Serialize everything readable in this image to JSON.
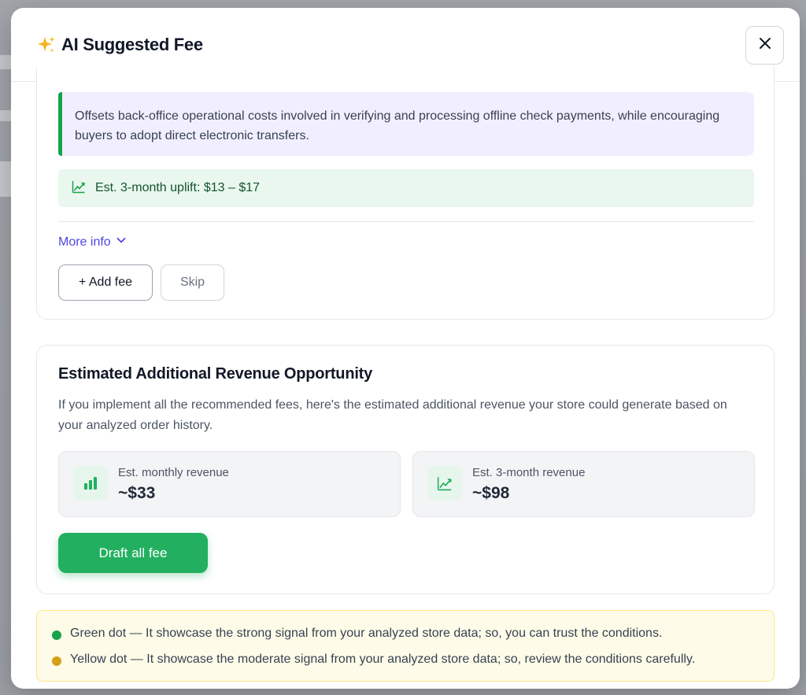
{
  "modal": {
    "title": "AI Suggested Fee",
    "close_icon": "close-icon",
    "sparkle_icon": "sparkle-icon"
  },
  "fee_card": {
    "description": "Offsets back-office operational costs involved in verifying and processing offline check payments, while encouraging buyers to adopt direct electronic transfers.",
    "uplift_icon": "trend-up-icon",
    "uplift_text": "Est. 3-month uplift: $13 – $17",
    "more_info_label": "More info",
    "add_fee_label": "+ Add fee",
    "skip_label": "Skip"
  },
  "revenue_card": {
    "title": "Estimated Additional Revenue Opportunity",
    "subtitle": "If you implement all the recommended fees, here's the estimated additional revenue your store could generate based on your analyzed order history.",
    "stats": [
      {
        "icon": "bar-chart-icon",
        "label": "Est. monthly revenue",
        "value": "~$33"
      },
      {
        "icon": "trend-up-icon",
        "label": "Est. 3-month revenue",
        "value": "~$98"
      }
    ],
    "draft_button_label": "Draft all fee"
  },
  "legend": {
    "items": [
      {
        "color": "#16a34a",
        "text": "Green dot — It showcase the strong signal from your analyzed store data; so, you can trust the conditions."
      },
      {
        "color": "#d4a017",
        "text": "Yellow dot — It showcase the moderate signal from your analyzed store data; so, review the conditions carefully."
      }
    ]
  },
  "colors": {
    "accent_green": "#22b060",
    "link_indigo": "#4f46e5",
    "description_bg": "#f1efff",
    "uplift_bg": "#e9f7ee",
    "legend_bg": "#fefce8"
  }
}
